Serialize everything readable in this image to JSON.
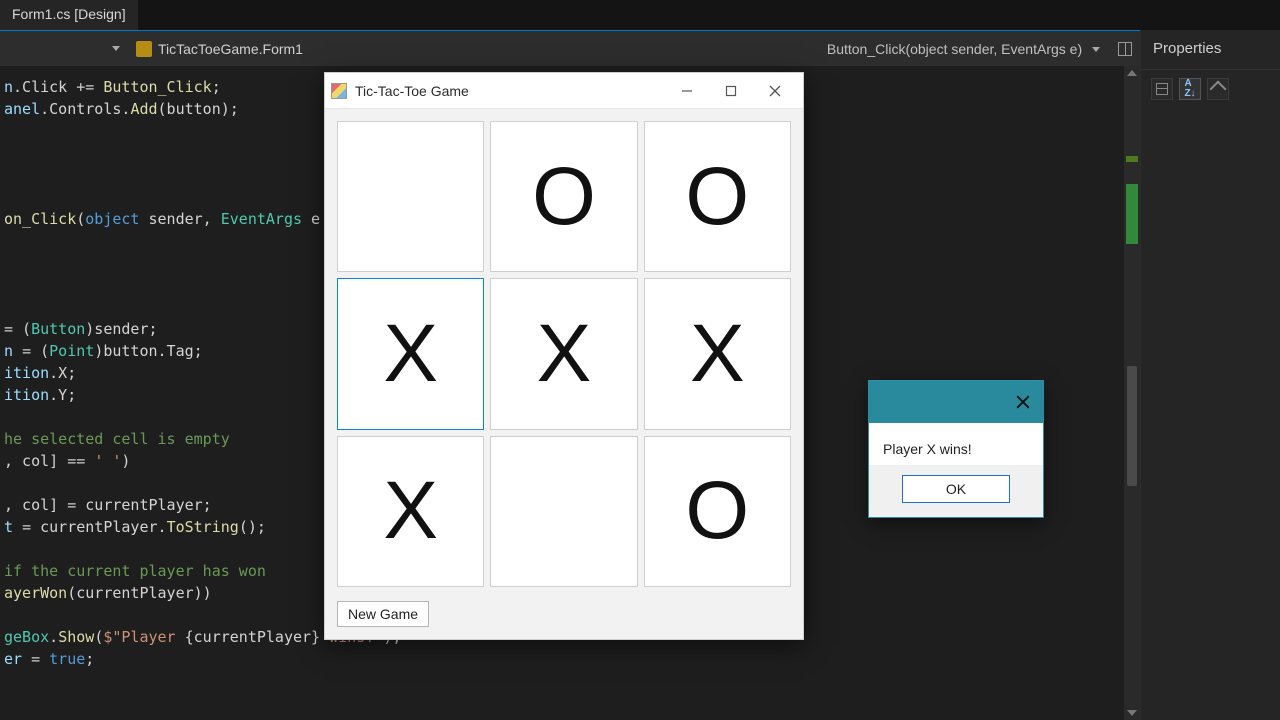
{
  "ide": {
    "doc_tab": "Form1.cs [Design]",
    "file_tab": "TicTacToeGame.Form1",
    "method_dropdown": "Button_Click(object sender, EventArgs e)",
    "properties_title": "Properties"
  },
  "code_lines": [
    {
      "html": "<span class='c-id'>n</span>.Click <span class='c-op'>+=</span> <span class='c-mt'>Button_Click</span>;"
    },
    {
      "html": "<span class='c-id'>anel</span>.Controls.<span class='c-mt'>Add</span>(button);"
    },
    {
      "html": ""
    },
    {
      "html": ""
    },
    {
      "html": ""
    },
    {
      "html": ""
    },
    {
      "html": "<span class='c-mt'>on_Click</span>(<span class='c-kw'>object</span> sender, <span class='c-ty'>EventArgs</span> e"
    },
    {
      "html": ""
    },
    {
      "html": ""
    },
    {
      "html": ""
    },
    {
      "html": ""
    },
    {
      "html": "<span class='c-op'>=</span> (<span class='c-ty'>Button</span>)sender;"
    },
    {
      "html": "<span class='c-id'>n</span> <span class='c-op'>=</span> (<span class='c-ty'>Point</span>)button.Tag;"
    },
    {
      "html": "<span class='c-id'>ition</span>.X;"
    },
    {
      "html": "<span class='c-id'>ition</span>.Y;"
    },
    {
      "html": ""
    },
    {
      "html": "<span class='c-cm'>he selected cell is empty</span>"
    },
    {
      "html": ", col] <span class='c-op'>==</span> <span class='c-st'>' '</span>)"
    },
    {
      "html": ""
    },
    {
      "html": ", col] <span class='c-op'>=</span> currentPlayer;"
    },
    {
      "html": "<span class='c-id'>t</span> <span class='c-op'>=</span> currentPlayer.<span class='c-mt'>ToString</span>();"
    },
    {
      "html": ""
    },
    {
      "html": "<span class='c-cm'>if the current player has won</span>"
    },
    {
      "html": "<span class='c-mt'>ayerWon</span>(currentPlayer))"
    },
    {
      "html": ""
    },
    {
      "html": "<span class='c-ty'>geBox</span>.<span class='c-mt'>Show</span>(<span class='c-st'>$\"Player </span>{currentPlayer}<span class='c-st'> wins!\"</span>);"
    },
    {
      "html": "<span class='c-id'>er</span> <span class='c-op'>=</span> <span class='c-kw'>true</span>;"
    }
  ],
  "winform": {
    "title": "Tic-Tac-Toe Game",
    "new_game_label": "New Game",
    "board": [
      "",
      "O",
      "O",
      "X",
      "X",
      "X",
      "X",
      "",
      "O"
    ],
    "highlight_index": 3
  },
  "msgbox": {
    "text": "Player X wins!",
    "ok_label": "OK"
  }
}
